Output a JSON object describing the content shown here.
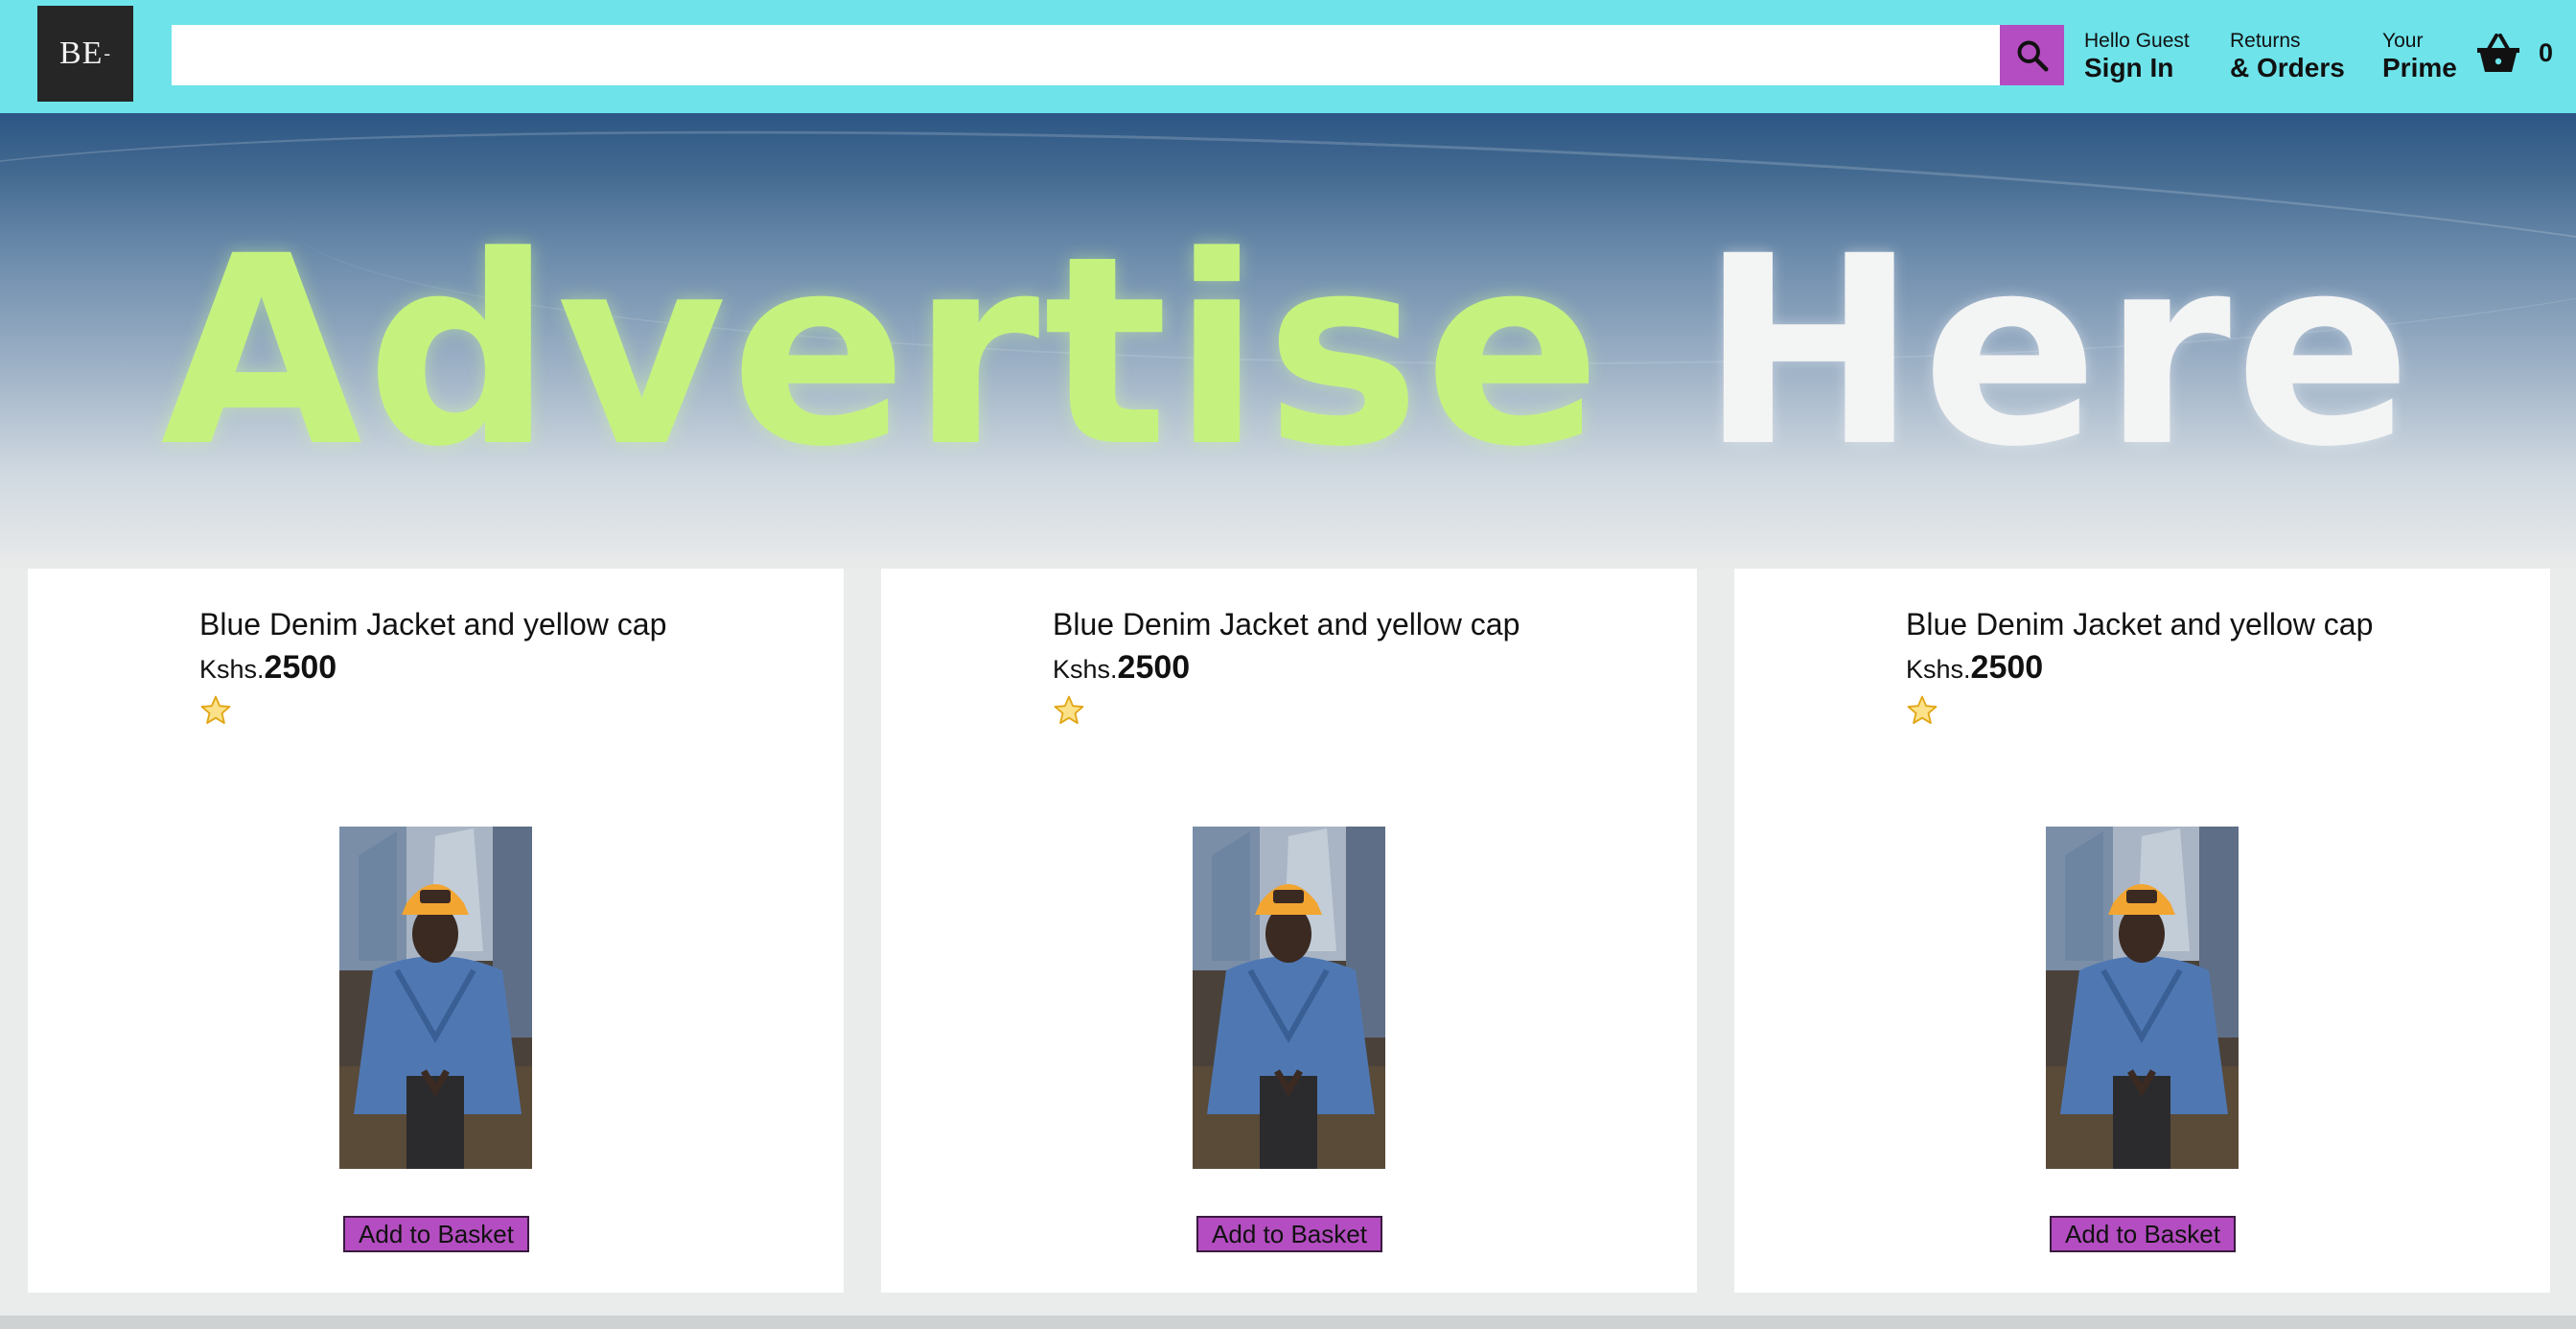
{
  "header": {
    "logo_text": "BE",
    "logo_dash": "-",
    "search": {
      "value": "",
      "placeholder": ""
    },
    "nav": [
      {
        "line1": "Hello Guest",
        "line2": "Sign In"
      },
      {
        "line1": "Returns",
        "line2": "& Orders"
      },
      {
        "line1": "Your",
        "line2": "Prime"
      }
    ],
    "basket_count": "0"
  },
  "banner": {
    "word1": "Advertise",
    "word2": "Here"
  },
  "products": [
    {
      "title": "Blue Denim Jacket and yellow cap",
      "currency": "Kshs.",
      "price": "2500",
      "rating": 1,
      "button": "Add to Basket"
    },
    {
      "title": "Blue Denim Jacket and yellow cap",
      "currency": "Kshs.",
      "price": "2500",
      "rating": 1,
      "button": "Add to Basket"
    },
    {
      "title": "Blue Denim Jacket and yellow cap",
      "currency": "Kshs.",
      "price": "2500",
      "rating": 1,
      "button": "Add to Basket"
    }
  ],
  "colors": {
    "header_bg": "#6ee3ea",
    "accent": "#b44dc1",
    "logo_bg": "#262626",
    "page_bg": "#eaebeb"
  },
  "icons": [
    "search-icon",
    "basket-icon",
    "star-icon"
  ]
}
